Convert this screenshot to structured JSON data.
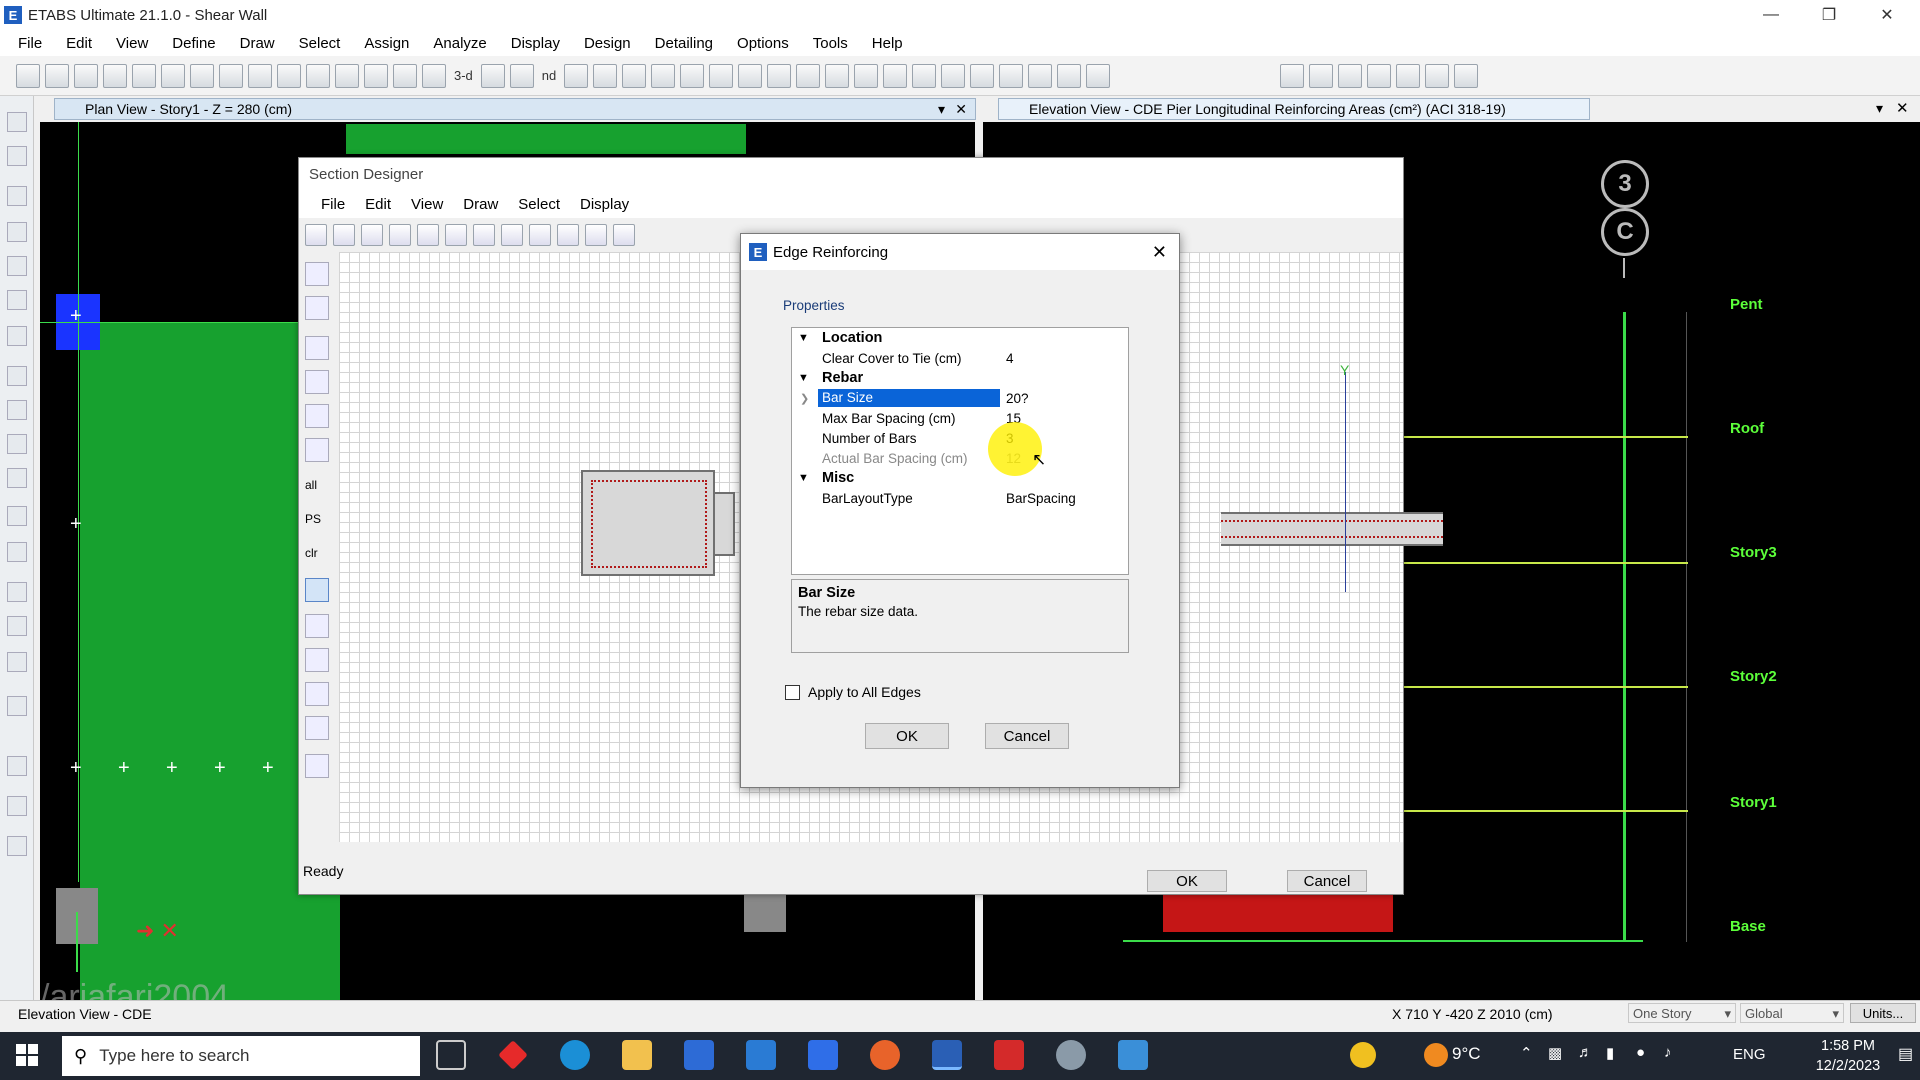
{
  "app": {
    "title": "ETABS Ultimate 21.1.0 - Shear Wall"
  },
  "menu": [
    "File",
    "Edit",
    "View",
    "Define",
    "Draw",
    "Select",
    "Assign",
    "Analyze",
    "Display",
    "Design",
    "Detailing",
    "Options",
    "Tools",
    "Help"
  ],
  "toolbar": {
    "label_3d": "3-d",
    "label_nd": "nd"
  },
  "plan_view": {
    "tab": "Plan View - Story1 - Z = 280 (cm)"
  },
  "elevation_view": {
    "tab": "Elevation View - CDE  Pier Longitudinal Reinforcing Areas (cm²)  (ACI 318-19)",
    "grid_bubbles": [
      "3",
      "C"
    ],
    "levels": [
      "Pent",
      "Roof",
      "Story3",
      "Story2",
      "Story1",
      "Base"
    ]
  },
  "section_designer": {
    "title": "Section Designer",
    "menu": [
      "File",
      "Edit",
      "View",
      "Draw",
      "Select",
      "Display"
    ],
    "side_labels": [
      "all",
      "PS",
      "clr"
    ],
    "status": "Ready",
    "ok": "OK",
    "cancel": "Cancel"
  },
  "edge_dialog": {
    "title": "Edge Reinforcing",
    "group_label": "Properties",
    "categories": {
      "location": "Location",
      "rebar": "Rebar",
      "misc": "Misc"
    },
    "props": {
      "clear_cover": {
        "name": "Clear Cover to Tie (cm)",
        "value": "4"
      },
      "bar_size": {
        "name": "Bar Size",
        "value": "20?"
      },
      "max_spacing": {
        "name": "Max Bar Spacing (cm)",
        "value": "15"
      },
      "num_bars": {
        "name": "Number of Bars",
        "value": "3"
      },
      "actual_spacing": {
        "name": "Actual Bar Spacing (cm)",
        "value": "12"
      },
      "layout_type": {
        "name": "BarLayoutType",
        "value": "BarSpacing"
      }
    },
    "desc_title": "Bar Size",
    "desc_text": "The rebar size data.",
    "apply_all": "Apply to All Edges",
    "ok": "OK",
    "cancel": "Cancel"
  },
  "status_bar": {
    "view": "Elevation View - CDE",
    "coords": "X 710  Y -420  Z 2010 (cm)",
    "story": "One Story",
    "coord_sys": "Global",
    "units": "Units..."
  },
  "watermark": "/ariafari2004",
  "taskbar": {
    "search": "Type here to search",
    "temp": "9°C",
    "lang": "ENG",
    "time": "1:58 PM",
    "date": "12/2/2023"
  }
}
